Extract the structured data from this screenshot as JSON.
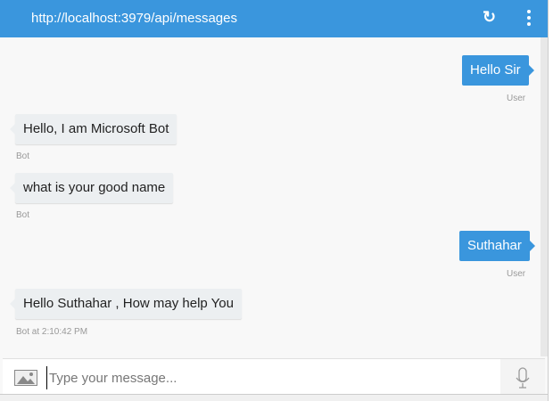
{
  "header": {
    "title": "http://localhost:3979/api/messages",
    "refresh_icon": "refresh-icon",
    "menu_icon": "more-vert-icon"
  },
  "messages": [
    {
      "from": "user",
      "text": "Hello Sir",
      "meta": "User"
    },
    {
      "from": "bot",
      "text": "Hello, I am Microsoft Bot",
      "meta": "Bot"
    },
    {
      "from": "bot",
      "text": "what is your good name",
      "meta": "Bot"
    },
    {
      "from": "user",
      "text": "Suthahar",
      "meta": "User"
    },
    {
      "from": "bot",
      "text": "Hello Suthahar , How may help You",
      "meta": "Bot at 2:10:42 PM"
    }
  ],
  "input": {
    "placeholder": "Type your message...",
    "value": ""
  },
  "colors": {
    "accent": "#3a96dd",
    "bot_bubble": "#eceff1"
  }
}
